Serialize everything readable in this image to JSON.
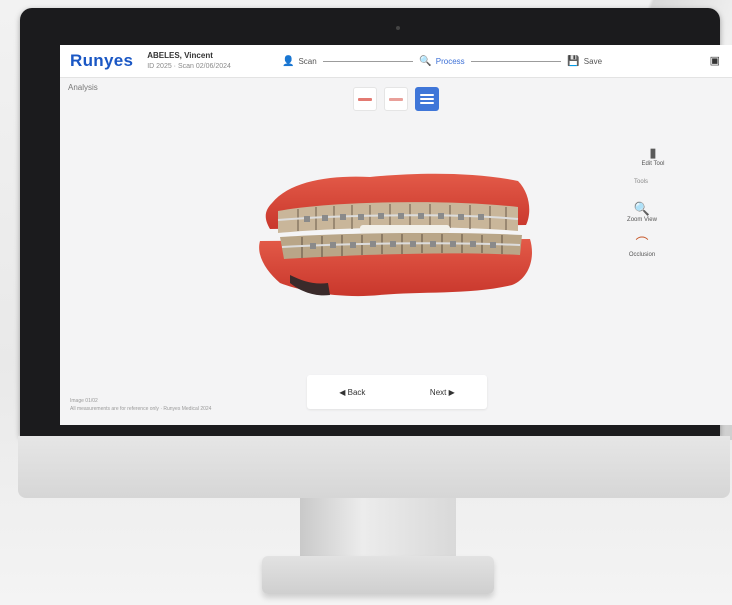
{
  "app": {
    "logo": "Runyes",
    "patient_name": "ABELES, Vincent",
    "patient_sub": "ID 2025 · Scan 02/06/2024"
  },
  "steps": [
    {
      "label": "Scan",
      "icon": "person-icon",
      "active": false
    },
    {
      "label": "Process",
      "icon": "magnify-icon",
      "active": true
    },
    {
      "label": "Save",
      "icon": "save-icon",
      "active": false
    }
  ],
  "section_label": "Analysis",
  "view_toggles": [
    "upper-jaw",
    "lower-jaw",
    "both-jaws"
  ],
  "tools": {
    "heading": "Tools",
    "items": [
      {
        "label": "Edit Tool",
        "icon": "edit-icon"
      },
      {
        "label": "Zoom View",
        "icon": "search-icon"
      },
      {
        "label": "Occlusion",
        "icon": "arch-icon"
      }
    ]
  },
  "nav": {
    "back": "◀ Back",
    "next": "Next ▶"
  },
  "footnote": {
    "line1": "Image 01/02",
    "line2": "All measurements are for reference only · Runyes Medical 2024"
  },
  "colors": {
    "brand_blue": "#1a57c4",
    "active_blue": "#3f76d8",
    "gum_red": "#d9473a"
  }
}
